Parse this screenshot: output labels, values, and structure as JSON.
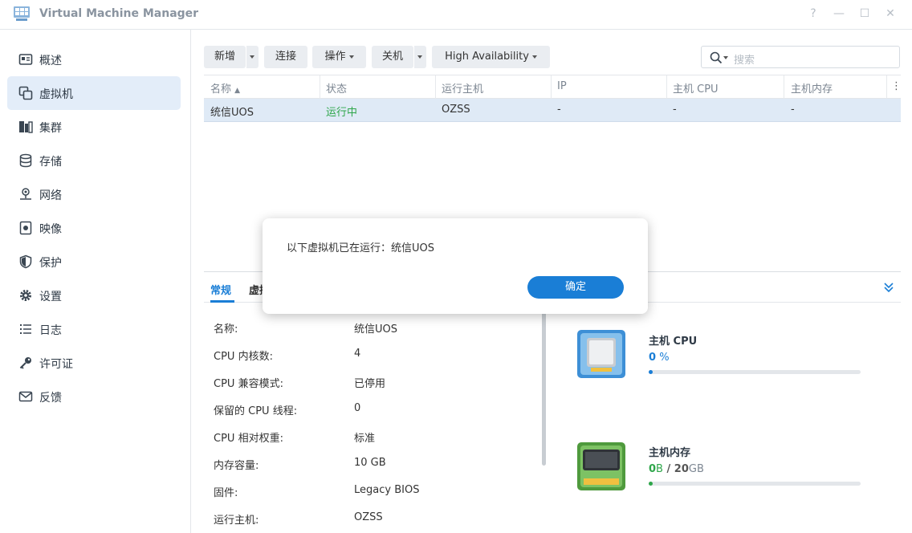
{
  "window": {
    "title": "Virtual Machine Manager",
    "controls": [
      "?",
      "—",
      "☐",
      "✕"
    ]
  },
  "sidebar": {
    "items": [
      {
        "label": "概述",
        "icon": "overview-icon"
      },
      {
        "label": "虚拟机",
        "icon": "vm-icon",
        "active": true
      },
      {
        "label": "集群",
        "icon": "cluster-icon"
      },
      {
        "label": "存储",
        "icon": "storage-icon"
      },
      {
        "label": "网络",
        "icon": "network-icon"
      },
      {
        "label": "映像",
        "icon": "image-icon"
      },
      {
        "label": "保护",
        "icon": "shield-icon"
      },
      {
        "label": "设置",
        "icon": "gear-icon"
      },
      {
        "label": "日志",
        "icon": "log-icon"
      },
      {
        "label": "许可证",
        "icon": "key-icon"
      },
      {
        "label": "反馈",
        "icon": "mail-icon"
      }
    ]
  },
  "toolbar": {
    "new_label": "新增",
    "connect_label": "连接",
    "action_label": "操作",
    "shutdown_label": "关机",
    "ha_label": "High Availability",
    "search_placeholder": "搜索"
  },
  "table": {
    "columns": [
      "名称",
      "状态",
      "运行主机",
      "IP",
      "主机 CPU",
      "主机内存"
    ],
    "rows": [
      {
        "name": "统信UOS",
        "status": "运行中",
        "host": "OZSS",
        "ip": "-",
        "cpu": "-",
        "mem": "-"
      }
    ]
  },
  "detail": {
    "tabs": [
      "常规",
      "虚拟"
    ],
    "properties": [
      {
        "key": "名称:",
        "value": "统信UOS"
      },
      {
        "key": "CPU 内核数:",
        "value": "4"
      },
      {
        "key": "CPU 兼容模式:",
        "value": "已停用"
      },
      {
        "key": "保留的 CPU 线程:",
        "value": "0"
      },
      {
        "key": "CPU 相对权重:",
        "value": "标准"
      },
      {
        "key": "内存容量:",
        "value": "10 GB"
      },
      {
        "key": "固件:",
        "value": "Legacy BIOS"
      },
      {
        "key": "运行主机:",
        "value": "OZSS"
      }
    ],
    "resources": {
      "cpu": {
        "title": "主机 CPU",
        "value": "0",
        "unit": "%",
        "percent": 0
      },
      "memory": {
        "title": "主机内存",
        "used": "0",
        "used_unit": "B",
        "sep": " / ",
        "total": "20",
        "total_unit": "GB",
        "percent": 0
      }
    }
  },
  "dialog": {
    "message": "以下虚拟机已在运行：统信UOS",
    "ok_label": "确定"
  },
  "colors": {
    "accent": "#1a7ed6",
    "running": "#2ea64a",
    "selected_row": "#dfeaf6"
  }
}
